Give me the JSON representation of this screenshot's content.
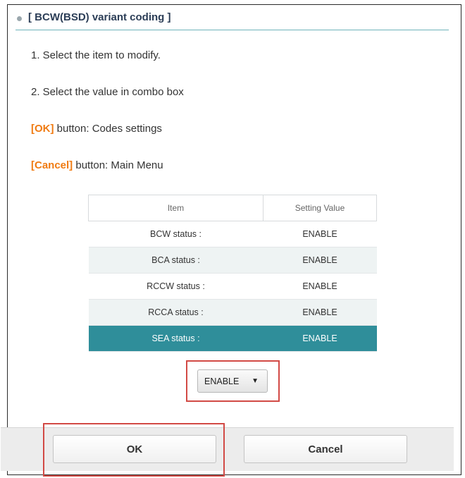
{
  "header": {
    "title": "[ BCW(BSD) variant coding ]",
    "dot_icon": "bullet-dot-icon"
  },
  "instructions": {
    "step1": "1. Select the item to modify.",
    "step2": "2. Select the value in combo box",
    "ok_key": "[OK]",
    "ok_desc": " button: Codes settings",
    "cancel_key": "[Cancel]",
    "cancel_desc": " button: Main Menu"
  },
  "table": {
    "columns": [
      "Item",
      "Setting Value"
    ],
    "rows": [
      {
        "item": "BCW status :",
        "value": "ENABLE"
      },
      {
        "item": "BCA status :",
        "value": "ENABLE"
      },
      {
        "item": "RCCW status :",
        "value": "ENABLE"
      },
      {
        "item": "RCCA status :",
        "value": "ENABLE"
      },
      {
        "item": "SEA status :",
        "value": "ENABLE"
      }
    ],
    "selected_row": 4
  },
  "combo": {
    "value": "ENABLE",
    "arrow_icon": "caret-down-icon"
  },
  "buttons": {
    "ok": "OK",
    "cancel": "Cancel"
  },
  "colors": {
    "accent_orange": "#f07b12",
    "selected_row": "#2f8e9a",
    "highlight_red": "#d24a45",
    "title_blue": "#2c3e57"
  }
}
